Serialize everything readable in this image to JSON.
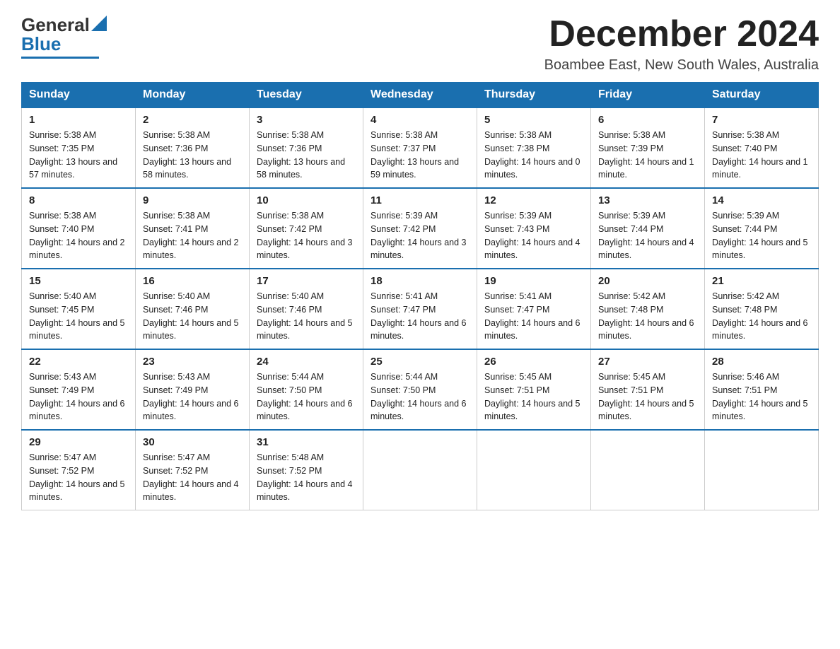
{
  "header": {
    "logo_text_general": "General",
    "logo_text_blue": "Blue",
    "month_title": "December 2024",
    "subtitle": "Boambee East, New South Wales, Australia"
  },
  "days_of_week": [
    "Sunday",
    "Monday",
    "Tuesday",
    "Wednesday",
    "Thursday",
    "Friday",
    "Saturday"
  ],
  "weeks": [
    [
      {
        "date": "1",
        "sunrise": "5:38 AM",
        "sunset": "7:35 PM",
        "daylight": "13 hours and 57 minutes."
      },
      {
        "date": "2",
        "sunrise": "5:38 AM",
        "sunset": "7:36 PM",
        "daylight": "13 hours and 58 minutes."
      },
      {
        "date": "3",
        "sunrise": "5:38 AM",
        "sunset": "7:36 PM",
        "daylight": "13 hours and 58 minutes."
      },
      {
        "date": "4",
        "sunrise": "5:38 AM",
        "sunset": "7:37 PM",
        "daylight": "13 hours and 59 minutes."
      },
      {
        "date": "5",
        "sunrise": "5:38 AM",
        "sunset": "7:38 PM",
        "daylight": "14 hours and 0 minutes."
      },
      {
        "date": "6",
        "sunrise": "5:38 AM",
        "sunset": "7:39 PM",
        "daylight": "14 hours and 1 minute."
      },
      {
        "date": "7",
        "sunrise": "5:38 AM",
        "sunset": "7:40 PM",
        "daylight": "14 hours and 1 minute."
      }
    ],
    [
      {
        "date": "8",
        "sunrise": "5:38 AM",
        "sunset": "7:40 PM",
        "daylight": "14 hours and 2 minutes."
      },
      {
        "date": "9",
        "sunrise": "5:38 AM",
        "sunset": "7:41 PM",
        "daylight": "14 hours and 2 minutes."
      },
      {
        "date": "10",
        "sunrise": "5:38 AM",
        "sunset": "7:42 PM",
        "daylight": "14 hours and 3 minutes."
      },
      {
        "date": "11",
        "sunrise": "5:39 AM",
        "sunset": "7:42 PM",
        "daylight": "14 hours and 3 minutes."
      },
      {
        "date": "12",
        "sunrise": "5:39 AM",
        "sunset": "7:43 PM",
        "daylight": "14 hours and 4 minutes."
      },
      {
        "date": "13",
        "sunrise": "5:39 AM",
        "sunset": "7:44 PM",
        "daylight": "14 hours and 4 minutes."
      },
      {
        "date": "14",
        "sunrise": "5:39 AM",
        "sunset": "7:44 PM",
        "daylight": "14 hours and 5 minutes."
      }
    ],
    [
      {
        "date": "15",
        "sunrise": "5:40 AM",
        "sunset": "7:45 PM",
        "daylight": "14 hours and 5 minutes."
      },
      {
        "date": "16",
        "sunrise": "5:40 AM",
        "sunset": "7:46 PM",
        "daylight": "14 hours and 5 minutes."
      },
      {
        "date": "17",
        "sunrise": "5:40 AM",
        "sunset": "7:46 PM",
        "daylight": "14 hours and 5 minutes."
      },
      {
        "date": "18",
        "sunrise": "5:41 AM",
        "sunset": "7:47 PM",
        "daylight": "14 hours and 6 minutes."
      },
      {
        "date": "19",
        "sunrise": "5:41 AM",
        "sunset": "7:47 PM",
        "daylight": "14 hours and 6 minutes."
      },
      {
        "date": "20",
        "sunrise": "5:42 AM",
        "sunset": "7:48 PM",
        "daylight": "14 hours and 6 minutes."
      },
      {
        "date": "21",
        "sunrise": "5:42 AM",
        "sunset": "7:48 PM",
        "daylight": "14 hours and 6 minutes."
      }
    ],
    [
      {
        "date": "22",
        "sunrise": "5:43 AM",
        "sunset": "7:49 PM",
        "daylight": "14 hours and 6 minutes."
      },
      {
        "date": "23",
        "sunrise": "5:43 AM",
        "sunset": "7:49 PM",
        "daylight": "14 hours and 6 minutes."
      },
      {
        "date": "24",
        "sunrise": "5:44 AM",
        "sunset": "7:50 PM",
        "daylight": "14 hours and 6 minutes."
      },
      {
        "date": "25",
        "sunrise": "5:44 AM",
        "sunset": "7:50 PM",
        "daylight": "14 hours and 6 minutes."
      },
      {
        "date": "26",
        "sunrise": "5:45 AM",
        "sunset": "7:51 PM",
        "daylight": "14 hours and 5 minutes."
      },
      {
        "date": "27",
        "sunrise": "5:45 AM",
        "sunset": "7:51 PM",
        "daylight": "14 hours and 5 minutes."
      },
      {
        "date": "28",
        "sunrise": "5:46 AM",
        "sunset": "7:51 PM",
        "daylight": "14 hours and 5 minutes."
      }
    ],
    [
      {
        "date": "29",
        "sunrise": "5:47 AM",
        "sunset": "7:52 PM",
        "daylight": "14 hours and 5 minutes."
      },
      {
        "date": "30",
        "sunrise": "5:47 AM",
        "sunset": "7:52 PM",
        "daylight": "14 hours and 4 minutes."
      },
      {
        "date": "31",
        "sunrise": "5:48 AM",
        "sunset": "7:52 PM",
        "daylight": "14 hours and 4 minutes."
      },
      null,
      null,
      null,
      null
    ]
  ]
}
